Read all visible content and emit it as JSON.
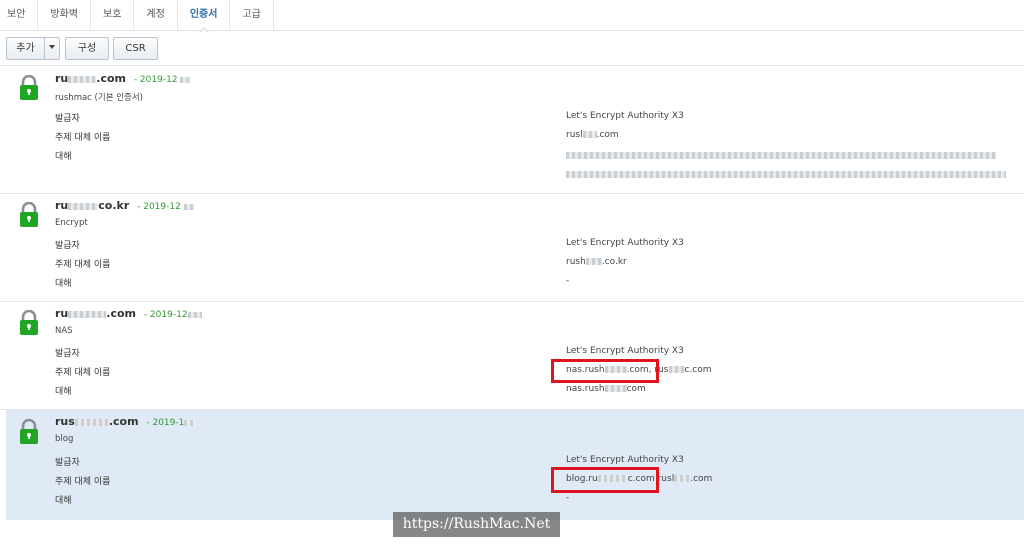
{
  "tabs": [
    {
      "label": "보안"
    },
    {
      "label": "방화벽"
    },
    {
      "label": "보호"
    },
    {
      "label": "계정"
    },
    {
      "label": "인증서"
    },
    {
      "label": "고급"
    }
  ],
  "toolbar": {
    "add_label": "추가",
    "config_label": "구성",
    "csr_label": "CSR"
  },
  "labels": {
    "issuer": "발급자",
    "alt_name": "주제 대체 이름",
    "for": "대해"
  },
  "certificates": [
    {
      "name_prefix": "ru",
      "name_suffix": ".com",
      "date": "- 2019-12",
      "desc": "rushmac (기본 인증서)",
      "issuer": "Let's Encrypt Authority X3",
      "alt_name_prefix": "rusl",
      "alt_name_suffix": ".com",
      "for": "-"
    },
    {
      "name_prefix": "ru",
      "name_suffix": "co.kr",
      "date": "- 2019-12",
      "desc": "Encrypt",
      "issuer": "Let's Encrypt Authority X3",
      "alt_name_prefix": "rush",
      "alt_name_suffix": ".co.kr",
      "for": "-"
    },
    {
      "name_prefix": "ru",
      "name_suffix": ".com",
      "date": "- 2019-12",
      "desc": "NAS",
      "issuer": "Let's Encrypt Authority X3",
      "alt_name_prefix": "nas.rush",
      "alt_name_suffix": ".com",
      "alt_name2_prefix": "rus",
      "alt_name2_suffix": "c.com",
      "for_prefix": "nas.rush",
      "for_suffix": "com"
    },
    {
      "name_prefix": "rus",
      "name_suffix": ".com",
      "date": "- 2019-1",
      "desc": "blog",
      "issuer": "Let's Encrypt Authority X3",
      "alt_name_prefix": "blog.ru",
      "alt_name_suffix": "c.com",
      "alt_name2_prefix": "rusl",
      "alt_name2_suffix": ".com",
      "for": "-"
    }
  ],
  "watermark": "https://RushMac.Net",
  "colors": {
    "accent": "#2f6ea8",
    "date_green": "#2e9a2e",
    "lock_green": "#21a525",
    "selected_bg": "#dfeaf6",
    "highlight_red": "#e0141e"
  }
}
